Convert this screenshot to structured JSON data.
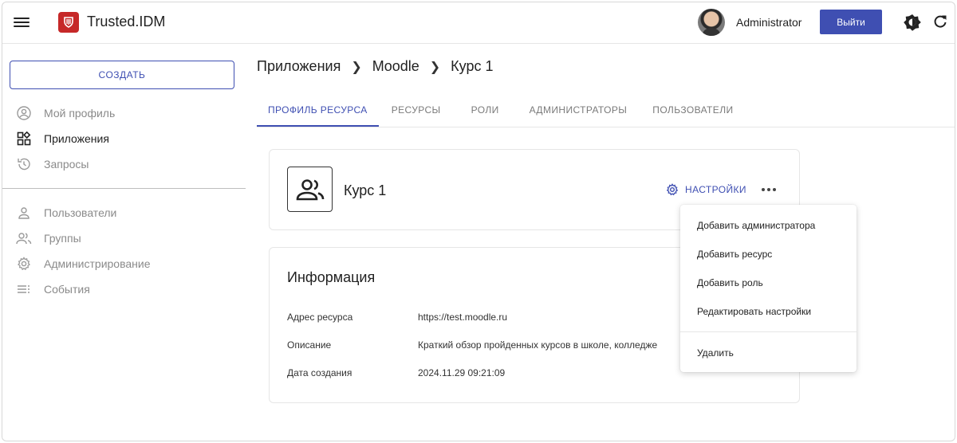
{
  "header": {
    "app_title": "Trusted.IDM",
    "user_name": "Administrator",
    "logout_label": "Выйти"
  },
  "sidebar": {
    "create_label": "СОЗДАТЬ",
    "items": [
      {
        "label": "Мой профиль",
        "icon": "account-circle-icon"
      },
      {
        "label": "Приложения",
        "icon": "apps-icon",
        "active": true
      },
      {
        "label": "Запросы",
        "icon": "history-icon"
      },
      {
        "label": "Пользователи",
        "icon": "person-icon"
      },
      {
        "label": "Группы",
        "icon": "group-icon"
      },
      {
        "label": "Администрирование",
        "icon": "gear-icon"
      },
      {
        "label": "События",
        "icon": "list-icon"
      }
    ]
  },
  "breadcrumb": [
    "Приложения",
    "Moodle",
    "Курс 1"
  ],
  "tabs": [
    {
      "label": "ПРОФИЛЬ РЕСУРСА",
      "active": true
    },
    {
      "label": "РЕСУРСЫ"
    },
    {
      "label": "РОЛИ"
    },
    {
      "label": "АДМИНИСТРАТОРЫ"
    },
    {
      "label": "ПОЛЬЗОВАТЕЛИ"
    }
  ],
  "resource": {
    "title": "Курс 1",
    "settings_label": "НАСТРОЙКИ"
  },
  "info": {
    "title": "Информация",
    "rows": [
      {
        "key": "Адрес ресурса",
        "value": "https://test.moodle.ru"
      },
      {
        "key": "Описание",
        "value": "Краткий обзор пройденных курсов в школе, колледже"
      },
      {
        "key": "Дата создания",
        "value": "2024.11.29 09:21:09"
      }
    ]
  },
  "menu": {
    "items": [
      "Добавить администратора",
      "Добавить ресурс",
      "Добавить роль",
      "Редактировать настройки"
    ],
    "delete_label": "Удалить"
  },
  "colors": {
    "accent": "#3f4fb2",
    "logo": "#c62828"
  }
}
